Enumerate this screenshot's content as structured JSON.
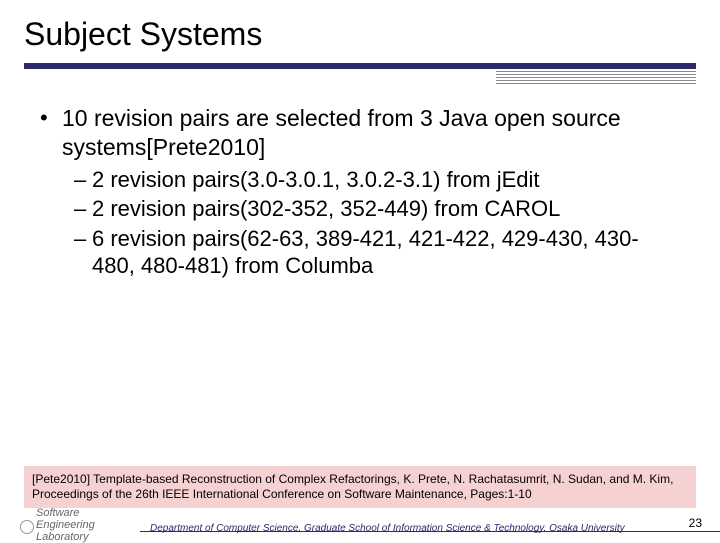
{
  "title": "Subject Systems",
  "bullet": {
    "text": "10 revision pairs are selected from 3 Java open source systems[Prete2010]"
  },
  "subitems": [
    "2 revision pairs(3.0-3.0.1, 3.0.2-3.1) from jEdit",
    "2 revision pairs(302-352, 352-449) from CAROL",
    "6 revision pairs(62-63, 389-421, 421-422, 429-430, 430-480, 480-481) from Columba"
  ],
  "reference": "[Pete2010] Template-based Reconstruction of Complex Refactorings, K. Prete, N. Rachatasumrit, N. Sudan, and M. Kim, Proceedings of the 26th IEEE International Conference on Software Maintenance, Pages:1-10",
  "footer": {
    "lab": "Software Engineering Laboratory",
    "dept": "Department of Computer Science, Graduate School of Information Science & Technology, Osaka University",
    "page": "23"
  }
}
